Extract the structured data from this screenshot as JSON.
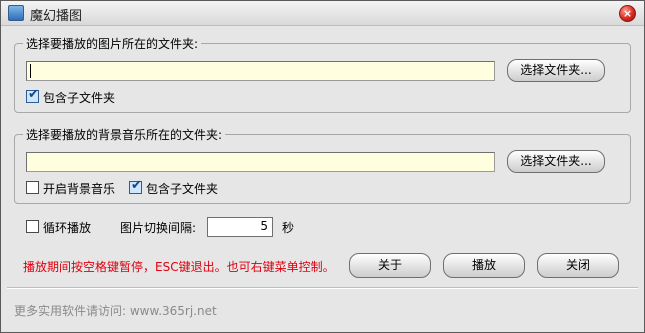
{
  "window": {
    "title": "魔幻播图",
    "close_glyph": "×"
  },
  "image_folder": {
    "legend": "选择要播放的图片所在的文件夹:",
    "path_value": "",
    "choose_label": "选择文件夹...",
    "include_subfolders_label": "包含子文件夹",
    "include_subfolders_checked": true
  },
  "music_folder": {
    "legend": "选择要播放的背景音乐所在的文件夹:",
    "path_value": "",
    "choose_label": "选择文件夹...",
    "enable_music_label": "开启背景音乐",
    "enable_music_checked": false,
    "include_subfolders_label": "包含子文件夹",
    "include_subfolders_checked": true
  },
  "options": {
    "loop_label": "循环播放",
    "loop_checked": false,
    "interval_label": "图片切换间隔:",
    "interval_value": "5",
    "interval_unit": "秒"
  },
  "hint": "播放期间按空格键暂停，ESC键退出。也可右键菜单控制。",
  "buttons": {
    "about": "关于",
    "play": "播放",
    "close": "关闭"
  },
  "footer": "更多实用软件请访问: www.365rj.net",
  "colors": {
    "field_bg": "#ffffe0",
    "hint_text": "#e0000f",
    "footer_text": "#8a8a8a"
  },
  "check_glyph": "✔"
}
